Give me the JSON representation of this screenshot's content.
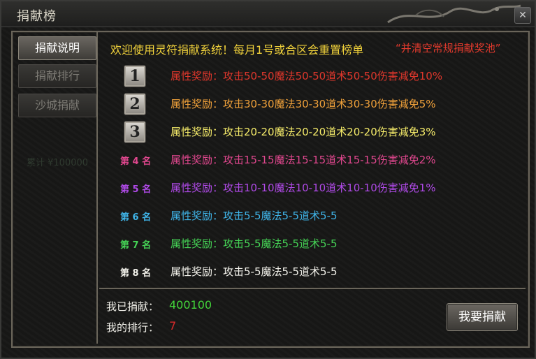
{
  "window": {
    "title": "捐献榜",
    "close_label": "✕"
  },
  "sidebar": {
    "items": [
      {
        "label": "捐献说明"
      },
      {
        "label": "捐献排行"
      },
      {
        "label": "沙城捐献"
      }
    ],
    "faint_text": "累计 ¥100000"
  },
  "main": {
    "header": "欢迎使用灵符捐献系统！每月1号或合区会重置榜单",
    "pool": "“并清空常规捐献奖池”",
    "ranks": [
      {
        "place": "1",
        "text": "属性奖励：攻击50-50魔法50-50道术50-50伤害减免10%",
        "color": "#e0372c"
      },
      {
        "place": "2",
        "text": "属性奖励：攻击30-30魔法30-30道术30-30伤害减免5%",
        "color": "#f0a13a"
      },
      {
        "place": "3",
        "text": "属性奖励：攻击20-20魔法20-20道术20-20伤害减免3%",
        "color": "#f6ec6a"
      },
      {
        "place": "第 4 名",
        "text": "属性奖励：攻击15-15魔法15-15道术15-15伤害减免2%",
        "color": "#e0478e"
      },
      {
        "place": "第 5 名",
        "text": "属性奖励：攻击10-10魔法10-10道术10-10伤害减免1%",
        "color": "#b04ae8"
      },
      {
        "place": "第 6 名",
        "text": "属性奖励：攻击5-5魔法5-5道术5-5",
        "color": "#3fb4e8"
      },
      {
        "place": "第 7 名",
        "text": "属性奖励：攻击5-5魔法5-5道术5-5",
        "color": "#45d255"
      },
      {
        "place": "第 8 名",
        "text": "属性奖励：攻击5-5魔法5-5道术5-5",
        "color": "#f2f1ea"
      }
    ]
  },
  "footer": {
    "donated_label": "我已捐献：",
    "donated_value": "400100",
    "rank_label": "我的排行：",
    "rank_value": "7",
    "donate_button": "我要捐献"
  },
  "colors": {
    "header": "#f1d23b",
    "pool": "#e23a2d",
    "donated": "#43d63a",
    "rank": "#d92a2a"
  }
}
